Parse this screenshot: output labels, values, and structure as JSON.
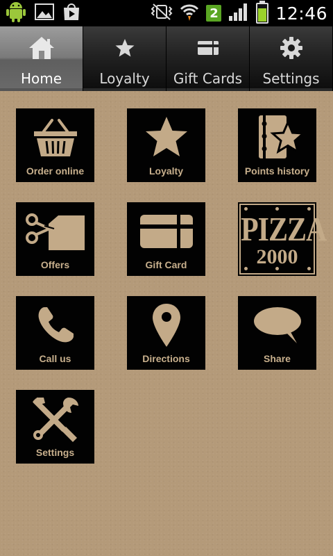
{
  "status_bar": {
    "time": "12:46",
    "notification_count": "2",
    "battery_level": 0.75,
    "icons": [
      "android-icon",
      "gallery-icon",
      "play-store-icon",
      "vibrate-mute-icon",
      "wifi-icon",
      "signal-icon",
      "battery-icon"
    ]
  },
  "tabs": [
    {
      "label": "Home",
      "icon": "home-icon",
      "active": true
    },
    {
      "label": "Loyalty",
      "icon": "star-icon",
      "active": false
    },
    {
      "label": "Gift Cards",
      "icon": "card-icon",
      "active": false
    },
    {
      "label": "Settings",
      "icon": "gear-icon",
      "active": false
    }
  ],
  "tiles": [
    {
      "label": "Order online",
      "icon": "basket-icon"
    },
    {
      "label": "Loyalty",
      "icon": "star-icon"
    },
    {
      "label": "Points history",
      "icon": "points-history-icon"
    },
    {
      "label": "Offers",
      "icon": "scissors-coupon-icon"
    },
    {
      "label": "Gift Card",
      "icon": "gift-card-icon"
    },
    {
      "logo_word": "PIZZA",
      "logo_number": "2000",
      "icon": "pizza-2000-logo"
    },
    {
      "label": "Call us",
      "icon": "phone-icon"
    },
    {
      "label": "Directions",
      "icon": "map-pin-icon"
    },
    {
      "label": "Share",
      "icon": "speech-bubble-icon"
    },
    {
      "label": "Settings",
      "icon": "wrench-screwdriver-icon"
    }
  ],
  "colors": {
    "background": "#b49a79",
    "tile_bg": "#020202",
    "tile_fg": "#c3aa88",
    "active_tab": "#7a7a7a",
    "status_badge": "#5aa623"
  }
}
